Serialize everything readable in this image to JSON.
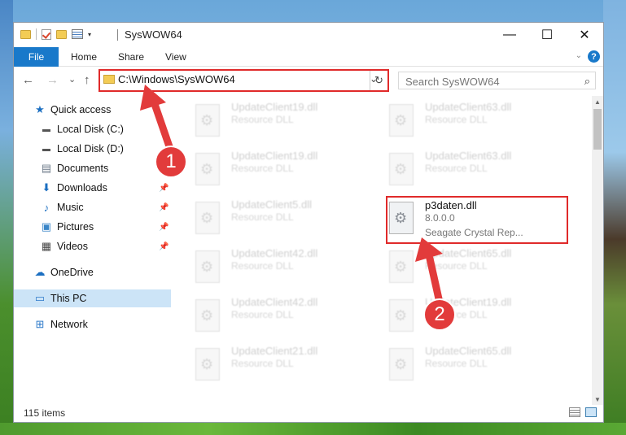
{
  "window": {
    "title": "SysWOW64",
    "controls": {
      "minimize": "—",
      "maximize": "☐",
      "close": "✕"
    }
  },
  "ribbon": {
    "tabs": [
      "File",
      "Home",
      "Share",
      "View"
    ]
  },
  "navigation": {
    "back": "←",
    "forward": "→",
    "recent": "⌄",
    "up": "↑",
    "address": "C:\\Windows\\SysWOW64",
    "search_placeholder": "Search SysWOW64"
  },
  "sidebar": {
    "items": [
      {
        "label": "Quick access",
        "icon": "star-icon"
      },
      {
        "label": "Local Disk (C:)",
        "icon": "drive-icon"
      },
      {
        "label": "Local Disk (D:)",
        "icon": "drive-icon"
      },
      {
        "label": "Documents",
        "icon": "documents-icon"
      },
      {
        "label": "Downloads",
        "icon": "downloads-icon",
        "pinned": true
      },
      {
        "label": "Music",
        "icon": "music-icon",
        "pinned": true
      },
      {
        "label": "Pictures",
        "icon": "pictures-icon",
        "pinned": true
      },
      {
        "label": "Videos",
        "icon": "videos-icon",
        "pinned": true
      },
      {
        "label": "OneDrive",
        "icon": "cloud-icon"
      },
      {
        "label": "This PC",
        "icon": "computer-icon",
        "selected": true
      },
      {
        "label": "Network",
        "icon": "network-icon"
      }
    ]
  },
  "files": {
    "left_column": [
      {
        "name": "UpdateClient19.dll",
        "type": "Resource DLL"
      },
      {
        "name": "UpdateClient19.dll",
        "type": "Resource DLL"
      },
      {
        "name": "UpdateClient5.dll",
        "type": "Resource DLL"
      },
      {
        "name": "UpdateClient42.dll",
        "type": "Resource DLL"
      },
      {
        "name": "UpdateClient42.dll",
        "type": "Resource DLL"
      },
      {
        "name": "UpdateClient21.dll",
        "type": "Resource DLL"
      }
    ],
    "right_column": [
      {
        "name": "UpdateClient63.dll",
        "type": "Resource DLL"
      },
      {
        "name": "UpdateClient63.dll",
        "type": "Resource DLL"
      },
      {
        "name": "p3daten.dll",
        "version": "8.0.0.0",
        "desc": "Seagate Crystal Rep...",
        "selected": true
      },
      {
        "name": "UpdateClient65.dll",
        "type": "Resource DLL"
      },
      {
        "name": "UpdateClient19.dll",
        "type": "Resource DLL"
      },
      {
        "name": "UpdateClient65.dll",
        "type": "Resource DLL"
      }
    ]
  },
  "status": {
    "item_count": "115 items"
  },
  "annotations": {
    "step1": "1",
    "step2": "2",
    "color": "#e23b3b"
  }
}
